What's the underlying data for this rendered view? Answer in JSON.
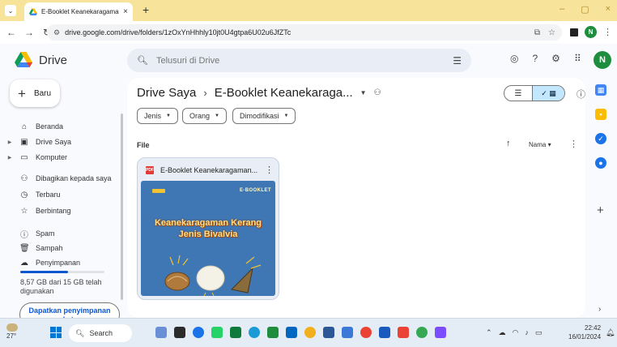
{
  "browser": {
    "tab_title": "E-Booklet Keanekaragaman Ker",
    "tab_close": "×",
    "new_tab": "+",
    "url": "drive.google.com/drive/folders/1zOxYnHhhly10jt0U4gtpa6U02u6JfZTc",
    "window_controls": [
      "–",
      "▢",
      "×"
    ]
  },
  "drive": {
    "app_name": "Drive",
    "search_placeholder": "Telusuri di Drive",
    "avatar_letter": "N"
  },
  "sidebar": {
    "new_label": "Baru",
    "items": [
      {
        "label": "Beranda",
        "icon": "home-icon",
        "glyph": "⌂",
        "caret": false
      },
      {
        "label": "Drive Saya",
        "icon": "my-drive-icon",
        "glyph": "▣",
        "caret": true
      },
      {
        "label": "Komputer",
        "icon": "computer-icon",
        "glyph": "▭",
        "caret": true
      },
      {
        "label": "Dibagikan kepada saya",
        "icon": "shared-icon",
        "glyph": "⚇",
        "caret": false
      },
      {
        "label": "Terbaru",
        "icon": "clock-icon",
        "glyph": "◷",
        "caret": false
      },
      {
        "label": "Berbintang",
        "icon": "star-icon",
        "glyph": "☆",
        "caret": false
      },
      {
        "label": "Spam",
        "icon": "spam-icon",
        "glyph": "ⓘ",
        "caret": false
      },
      {
        "label": "Sampah",
        "icon": "trash-icon",
        "glyph": "🗑",
        "caret": false
      },
      {
        "label": "Penyimpanan",
        "icon": "cloud-icon",
        "glyph": "☁",
        "caret": false
      }
    ],
    "storage_used_fraction": 0.571,
    "storage_text": "8,57 GB dari 15 GB telah digunakan",
    "get_storage": "Dapatkan penyimpanan ekstra"
  },
  "main": {
    "breadcrumb_root": "Drive Saya",
    "breadcrumb_sep": "›",
    "breadcrumb_current": "E-Booklet Keanekaraga...",
    "filters": [
      {
        "label": "Jenis"
      },
      {
        "label": "Orang"
      },
      {
        "label": "Dimodifikasi"
      }
    ],
    "section_label": "File",
    "sort_label": "Nama",
    "file": {
      "name": "E-Booklet Keanekaragaman...",
      "type_badge": "PDF",
      "thumb_tag": "E-BOOKLET",
      "thumb_title_line1": "Keanekaragaman Kerang",
      "thumb_title_line2": "Jenis Bivalvia"
    }
  },
  "taskbar": {
    "temperature": "27°",
    "search_label": "Search",
    "time": "22:42",
    "date": "16/01/2024",
    "app_colors": [
      "#6b8fd6",
      "#2b2b2b",
      "#1a73e8",
      "#25d366",
      "#0f7b3b",
      "#1a9bd7",
      "#1e8e3e",
      "#0067c0",
      "#f2b01e",
      "#2b5797",
      "#3c78d8",
      "#ea4335",
      "#185abd",
      "#ea4335",
      "#34a853",
      "#7c4dff"
    ]
  }
}
